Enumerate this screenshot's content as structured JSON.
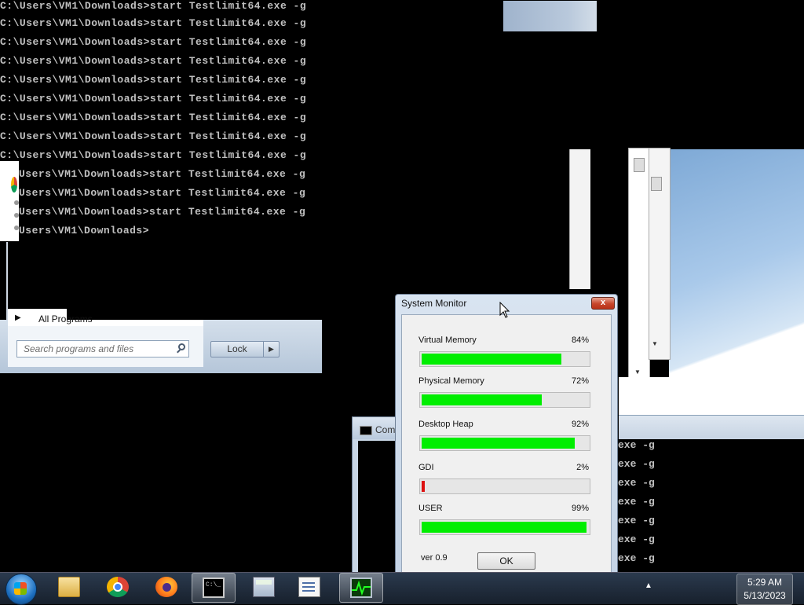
{
  "console": {
    "lines": [
      "C:\\Users\\VM1\\Downloads>start Testlimit64.exe -g",
      "C:\\Users\\VM1\\Downloads>start Testlimit64.exe -g",
      "C:\\Users\\VM1\\Downloads>start Testlimit64.exe -g",
      "C:\\Users\\VM1\\Downloads>start Testlimit64.exe -g",
      "C:\\Users\\VM1\\Downloads>start Testlimit64.exe -g",
      "C:\\Users\\VM1\\Downloads>start Testlimit64.exe -g",
      "C:\\Users\\VM1\\Downloads>start Testlimit64.exe -g",
      "C:\\Users\\VM1\\Downloads>start Testlimit64.exe -g",
      "C:\\Users\\VM1\\Downloads>start Testlimit64.exe -g",
      "Users\\VM1\\Downloads>start Testlimit64.exe -g",
      "Users\\VM1\\Downloads>start Testlimit64.exe -g",
      "Users\\VM1\\Downloads>start Testlimit64.exe -g",
      "Users\\VM1\\Downloads>"
    ]
  },
  "console2": {
    "title": "Com",
    "visible_lines": [
      "exe -g",
      "exe -g",
      "exe -g",
      "exe -g",
      "exe -g",
      "exe -g",
      "exe -g"
    ]
  },
  "start_menu": {
    "all_programs": "All Programs",
    "search_placeholder": "Search programs and files",
    "lock_label": "Lock",
    "lock_arrow": "▶"
  },
  "system_monitor": {
    "title": "System Monitor",
    "close_glyph": "x",
    "metrics": [
      {
        "label": "Virtual Memory",
        "percent_text": "84%",
        "percent": 84,
        "color": "#00ee00"
      },
      {
        "label": "Physical Memory",
        "percent_text": "72%",
        "percent": 72,
        "color": "#00ee00"
      },
      {
        "label": "Desktop Heap",
        "percent_text": "92%",
        "percent": 92,
        "color": "#00ee00"
      },
      {
        "label": "GDI",
        "percent_text": "2%",
        "percent": 2,
        "color": "#dd1111"
      },
      {
        "label": "USER",
        "percent_text": "99%",
        "percent": 99,
        "color": "#00ee00"
      }
    ],
    "version": "ver 0.9",
    "ok_label": "OK"
  },
  "taskbar": {
    "items": [
      {
        "icon": "explorer-icon"
      },
      {
        "icon": "chrome-icon"
      },
      {
        "icon": "firefox-icon"
      },
      {
        "icon": "cmd-icon",
        "active": true
      },
      {
        "icon": "calculator-icon"
      },
      {
        "icon": "notepad-icon"
      },
      {
        "icon": "system-monitor-icon",
        "active": true
      }
    ],
    "tray_arrow": "▲",
    "clock_time": "5:29 AM",
    "clock_date": "5/13/2023"
  }
}
